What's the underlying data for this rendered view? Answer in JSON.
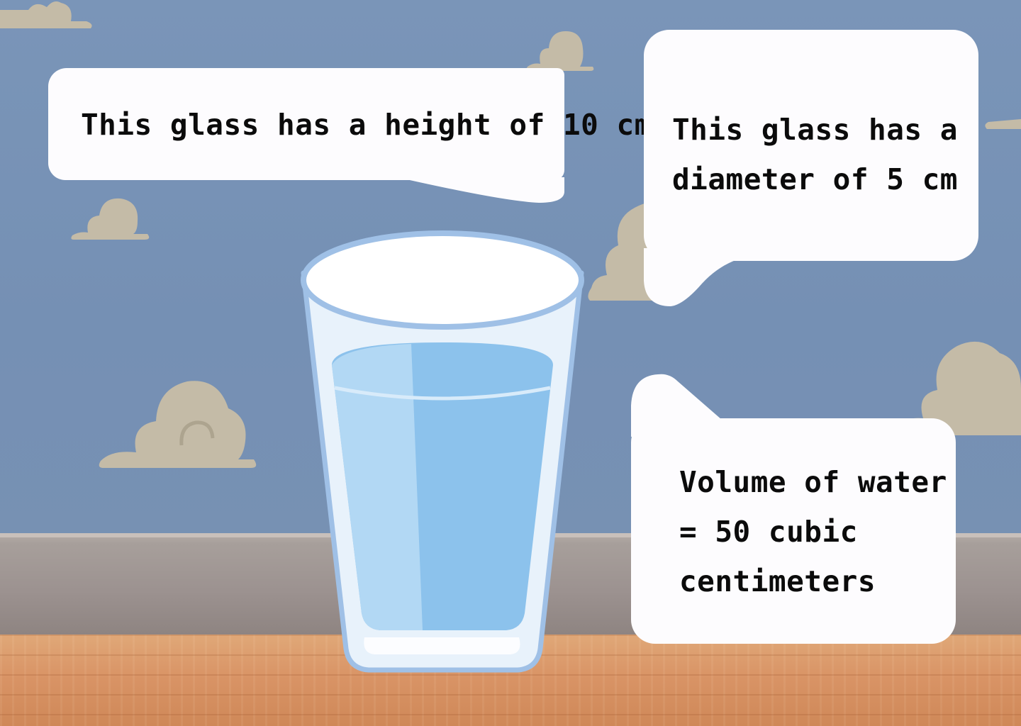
{
  "bubbles": {
    "height_text": "This glass has a height of 10 cm",
    "diameter_text": "This glass has a diameter of 5 cm",
    "volume_text": "Volume of water = 50 cubic centimeters"
  },
  "illustration": {
    "subject": "glass-of-water-icon",
    "background": "cartoon-clouds-wallpaper"
  },
  "colors": {
    "wall": "#7a95b8",
    "cloud": "#c4bba7",
    "floor": "#d99466",
    "water": "#8cc2ec",
    "bubble": "#fdfcfe"
  }
}
